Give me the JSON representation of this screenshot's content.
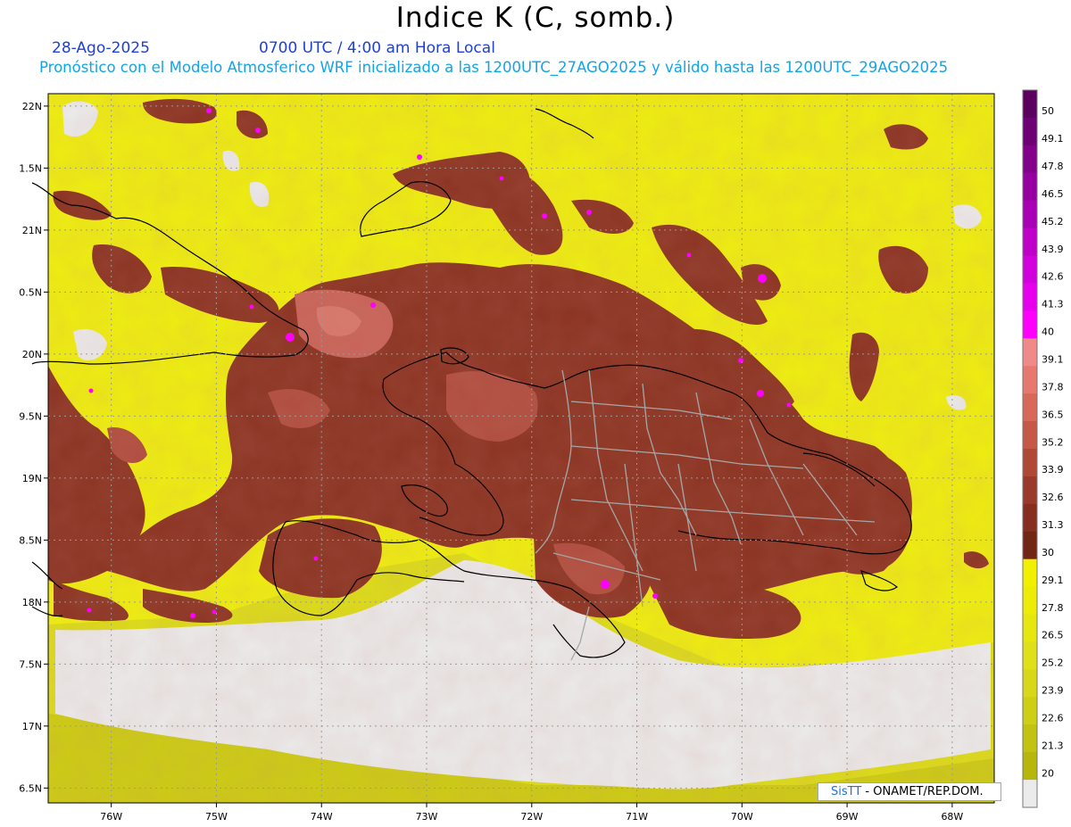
{
  "header": {
    "title": "Indice K (C, somb.)",
    "date": "28-Ago-2025",
    "time": "0700 UTC / 4:00 am Hora Local",
    "forecast": "Pronóstico con el Modelo Atmosferico WRF inicializado a las 1200UTC_27AGO2025 y válido hasta las  1200UTC_29AGO2025"
  },
  "map": {
    "extent": {
      "lon_min": -76.6,
      "lon_max": -67.6,
      "lat_min": 16.38,
      "lat_max": 22.1
    },
    "lat_labels": [
      "22N",
      "1.5N",
      "21N",
      "0.5N",
      "20N",
      "9.5N",
      "19N",
      "8.5N",
      "18N",
      "7.5N",
      "17N",
      "6.5N"
    ],
    "lat_values": [
      22,
      21.5,
      21,
      20.5,
      20,
      19.5,
      19,
      18.5,
      18,
      17.5,
      17,
      16.5
    ],
    "lon_labels": [
      "76W",
      "75W",
      "74W",
      "73W",
      "72W",
      "71W",
      "70W",
      "69W",
      "68W"
    ],
    "lon_values": [
      -76,
      -75,
      -74,
      -73,
      -72,
      -71,
      -70,
      -69,
      -68
    ],
    "colors": {
      "land": "#ebebeb",
      "coast": "#000000",
      "provinces": "#a6a6a6",
      "grid": "#9a9a9a"
    }
  },
  "colorbar": {
    "labels": [
      "50",
      "49.1",
      "47.8",
      "46.5",
      "45.2",
      "43.9",
      "42.6",
      "41.3",
      "40",
      "39.1",
      "37.8",
      "36.5",
      "35.2",
      "33.9",
      "32.6",
      "31.3",
      "30",
      "29.1",
      "27.8",
      "26.5",
      "25.2",
      "23.9",
      "22.6",
      "21.3",
      "20"
    ],
    "colors": [
      "#5c0060",
      "#6e0075",
      "#82008a",
      "#9600a0",
      "#aa00b5",
      "#be00c8",
      "#d200dc",
      "#e600ee",
      "#ff00ff",
      "#f08a8a",
      "#e67870",
      "#d86858",
      "#c65848",
      "#b04838",
      "#9a3a2c",
      "#862e20",
      "#742616",
      "#f0f000",
      "#ecec08",
      "#e6e610",
      "#e0e018",
      "#d8d818",
      "#cece14",
      "#c2c210",
      "#b6b60c",
      "#ebebeb"
    ]
  },
  "credit": {
    "sis": "SisTT",
    "rest": " - ONAMET/REP.DOM."
  }
}
